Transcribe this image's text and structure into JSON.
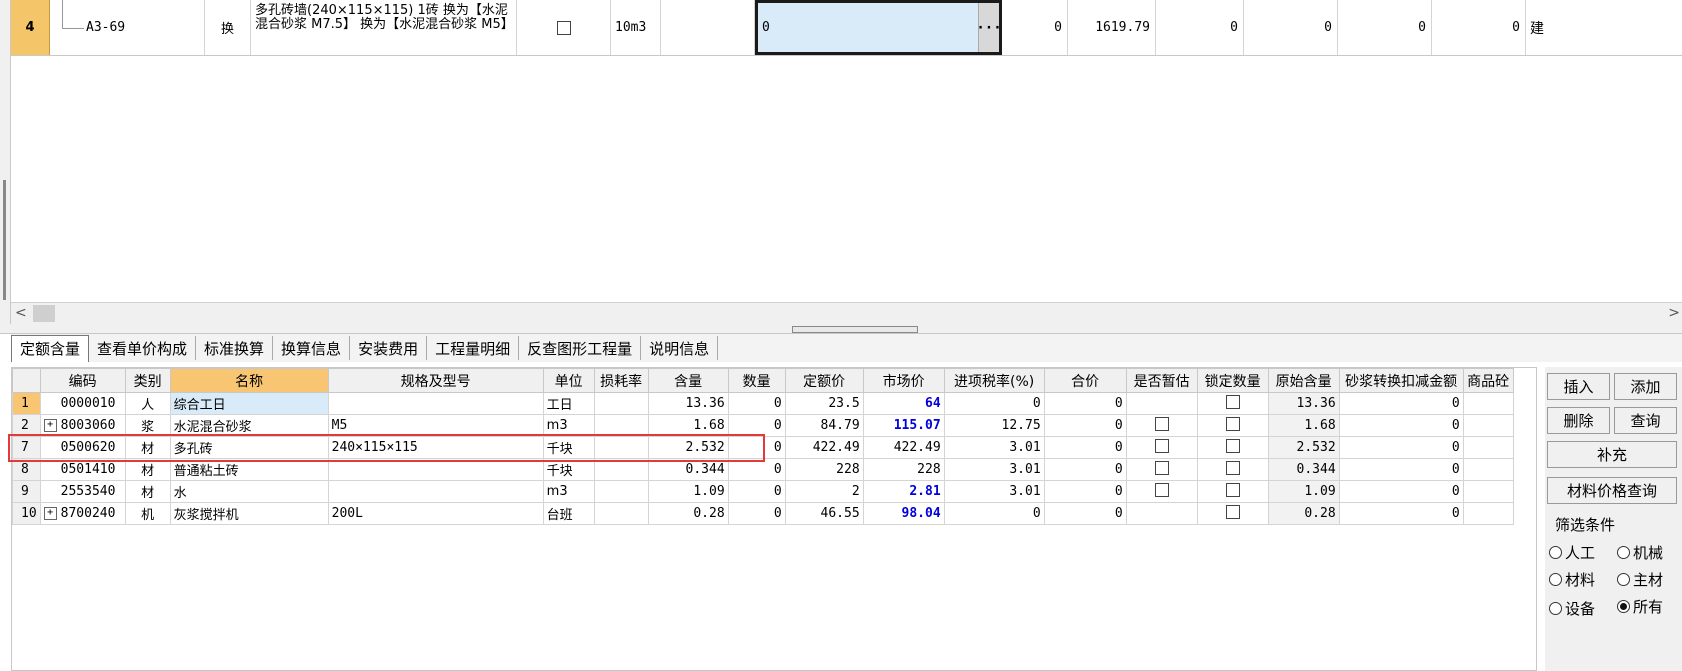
{
  "top_row": {
    "num": "4",
    "code": "A3-69",
    "type": "换",
    "name": "多孔砖墙(240×115×115) 1砖  换为【水泥混合砂浆 M7.5】  换为【水泥混合砂浆 M5】",
    "unit": "10m3",
    "edit_value": "0",
    "ellipsis": "···",
    "v1": "0",
    "v2": "1619.79",
    "v3": "0",
    "v4": "0",
    "v5": "0",
    "v6": "0",
    "last": "建"
  },
  "tabs": [
    "定额含量",
    "查看单价构成",
    "标准换算",
    "换算信息",
    "安装费用",
    "工程量明细",
    "反查图形工程量",
    "说明信息"
  ],
  "columns": [
    "编码",
    "类别",
    "名称",
    "规格及型号",
    "单位",
    "损耗率",
    "含量",
    "数量",
    "定额价",
    "市场价",
    "进项税率(%)",
    "合价",
    "是否暂估",
    "锁定数量",
    "原始含量",
    "砂浆转换扣减金额",
    "商品砼"
  ],
  "rows": [
    {
      "num": "1",
      "code": "0000010",
      "cat": "人",
      "name": "综合工日",
      "spec": "",
      "unit": "工日",
      "loss": "",
      "qty": "13.36",
      "count": "0",
      "quota": "23.5",
      "market": "64",
      "tax": "0",
      "total": "0",
      "est": false,
      "lock": true,
      "orig": "13.36",
      "mortar": "0"
    },
    {
      "num": "2",
      "code": "8003060",
      "cat": "浆",
      "name": "水泥混合砂浆",
      "spec": "M5",
      "unit": "m3",
      "loss": "",
      "qty": "1.68",
      "count": "0",
      "quota": "84.79",
      "market": "115.07",
      "tax": "12.75",
      "total": "0",
      "est": true,
      "lock": true,
      "orig": "1.68",
      "mortar": "0",
      "expand": "+"
    },
    {
      "num": "7",
      "code": "0500620",
      "cat": "材",
      "name": "多孔砖",
      "spec": "240×115×115",
      "unit": "千块",
      "loss": "",
      "qty": "2.532",
      "count": "0",
      "quota": "422.49",
      "market": "422.49",
      "tax": "3.01",
      "total": "0",
      "est": true,
      "lock": true,
      "orig": "2.532",
      "mortar": "0"
    },
    {
      "num": "8",
      "code": "0501410",
      "cat": "材",
      "name": "普通粘土砖",
      "spec": "",
      "unit": "千块",
      "loss": "",
      "qty": "0.344",
      "count": "0",
      "quota": "228",
      "market": "228",
      "tax": "3.01",
      "total": "0",
      "est": true,
      "lock": true,
      "orig": "0.344",
      "mortar": "0"
    },
    {
      "num": "9",
      "code": "2553540",
      "cat": "材",
      "name": "水",
      "spec": "",
      "unit": "m3",
      "loss": "",
      "qty": "1.09",
      "count": "0",
      "quota": "2",
      "market": "2.81",
      "tax": "3.01",
      "total": "0",
      "est": true,
      "lock": true,
      "orig": "1.09",
      "mortar": "0"
    },
    {
      "num": "10",
      "code": "8700240",
      "cat": "机",
      "name": "灰浆搅拌机",
      "spec": "200L",
      "unit": "台班",
      "loss": "",
      "qty": "0.28",
      "count": "0",
      "quota": "46.55",
      "market": "98.04",
      "tax": "0",
      "total": "0",
      "est": false,
      "lock": true,
      "orig": "0.28",
      "mortar": "0",
      "expand": "+"
    }
  ],
  "market_blue_rows": [
    "1",
    "2",
    "9",
    "10"
  ],
  "buttons": {
    "insert": "插入",
    "add": "添加",
    "delete": "删除",
    "query": "查询",
    "supplement": "补充",
    "price_query": "材料价格查询"
  },
  "filter": {
    "label": "筛选条件",
    "options": [
      {
        "label": "人工",
        "selected": false
      },
      {
        "label": "机械",
        "selected": false
      },
      {
        "label": "材料",
        "selected": false
      },
      {
        "label": "主材",
        "selected": false
      },
      {
        "label": "设备",
        "selected": false
      },
      {
        "label": "所有",
        "selected": true
      }
    ]
  },
  "colors": {
    "accent_orange": "#f8c572",
    "selection_blue": "#d9eaf8",
    "market_blue": "#0000e0",
    "highlight_red": "#e23a3a"
  }
}
